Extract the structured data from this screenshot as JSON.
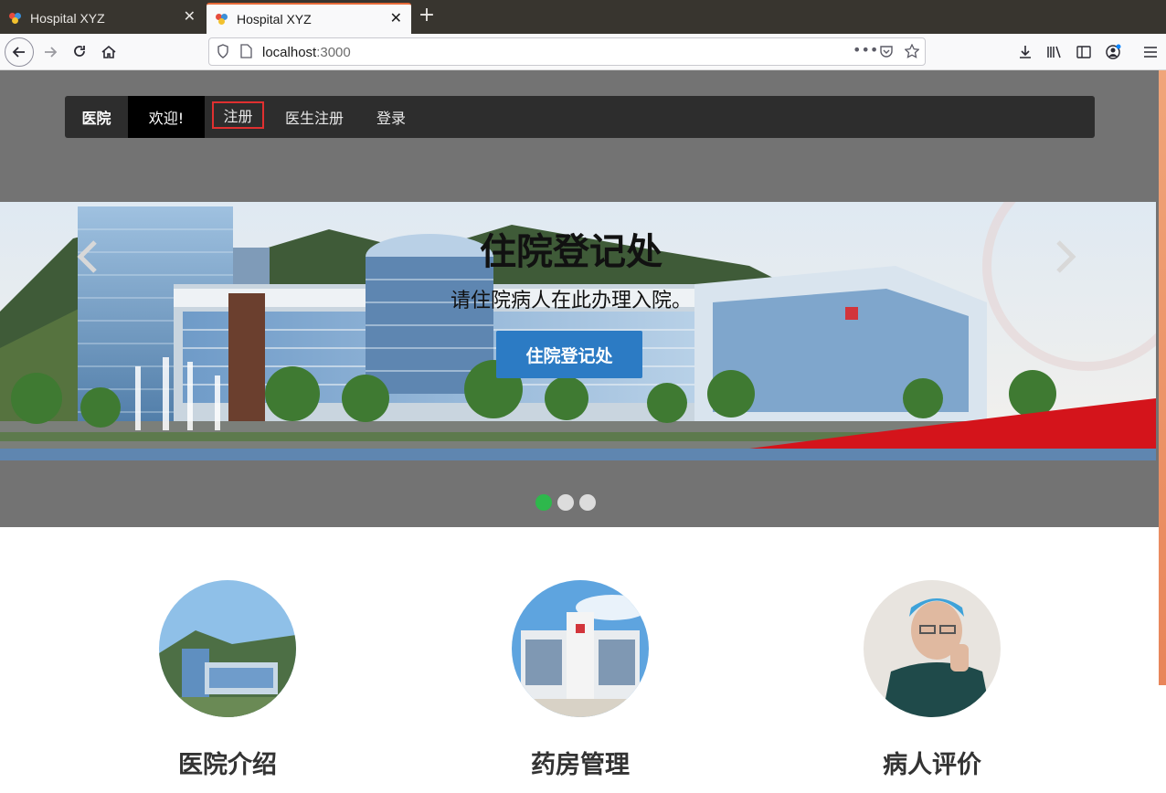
{
  "browser": {
    "tabs": [
      {
        "title": "Hospital XYZ",
        "active": false
      },
      {
        "title": "Hospital XYZ",
        "active": true
      }
    ],
    "url_host": "localhost",
    "url_port": ":3000",
    "accent_color": "#e66a38"
  },
  "site_nav": {
    "brand": "医院",
    "welcome": "欢迎!",
    "links": [
      {
        "label": "注册",
        "highlighted": true
      },
      {
        "label": "医生注册"
      },
      {
        "label": "登录"
      }
    ]
  },
  "carousel": {
    "title": "住院登记处",
    "subtitle": "请住院病人在此办理入院。",
    "button": "住院登记处",
    "prev_icon": "chevron-left-icon",
    "next_icon": "chevron-right-icon",
    "slides": 3,
    "active_slide": 1,
    "active_dot_color": "#2eb84c"
  },
  "features": [
    {
      "title": "医院介绍",
      "desc": ""
    },
    {
      "title": "药房管理",
      "desc": ""
    },
    {
      "title": "病人评价",
      "desc": ""
    }
  ]
}
